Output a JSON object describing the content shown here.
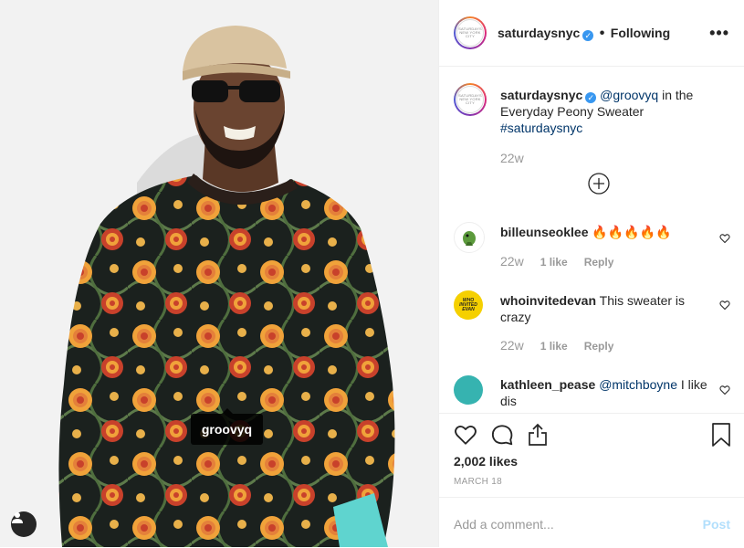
{
  "post": {
    "username": "saturdaysnyc",
    "follow_status": "Following",
    "avatar_text": "SATURDAYS NEW YORK CITY",
    "caption_mention": "@groovyq",
    "caption_text": " in the Everyday Peony Sweater",
    "caption_hashtag": "#saturdaysnyc",
    "caption_age": "22w",
    "likes": "2,002 likes",
    "date": "MARCH 18",
    "photo_tag": "groovyq"
  },
  "comments": [
    {
      "username": "billeunseoklee",
      "text": " 🔥🔥🔥🔥🔥",
      "age": "22w",
      "likes": "1 like",
      "reply": "Reply"
    },
    {
      "username": "whoinvitedevan",
      "text": " This sweater is crazy",
      "age": "22w",
      "likes": "1 like",
      "reply": "Reply",
      "avatar_text": "WHO INVITED EVAN"
    },
    {
      "username": "kathleen_pease",
      "mention": "@mitchboyne",
      "text": " I like dis"
    }
  ],
  "add_comment": {
    "placeholder": "Add a comment...",
    "post_label": "Post"
  },
  "icons": [
    "more-icon",
    "verified-icon",
    "load-more-icon",
    "heart-icon",
    "comment-icon",
    "share-icon",
    "bookmark-icon",
    "user-tag-icon"
  ],
  "colors": {
    "verified": "#3897f0",
    "link": "#003569",
    "muted": "#999999",
    "post_disabled": "#b2dffc",
    "sweater_base": "#1a1f1c",
    "flower_orange": "#f0a23a",
    "flower_red": "#c8412b"
  }
}
